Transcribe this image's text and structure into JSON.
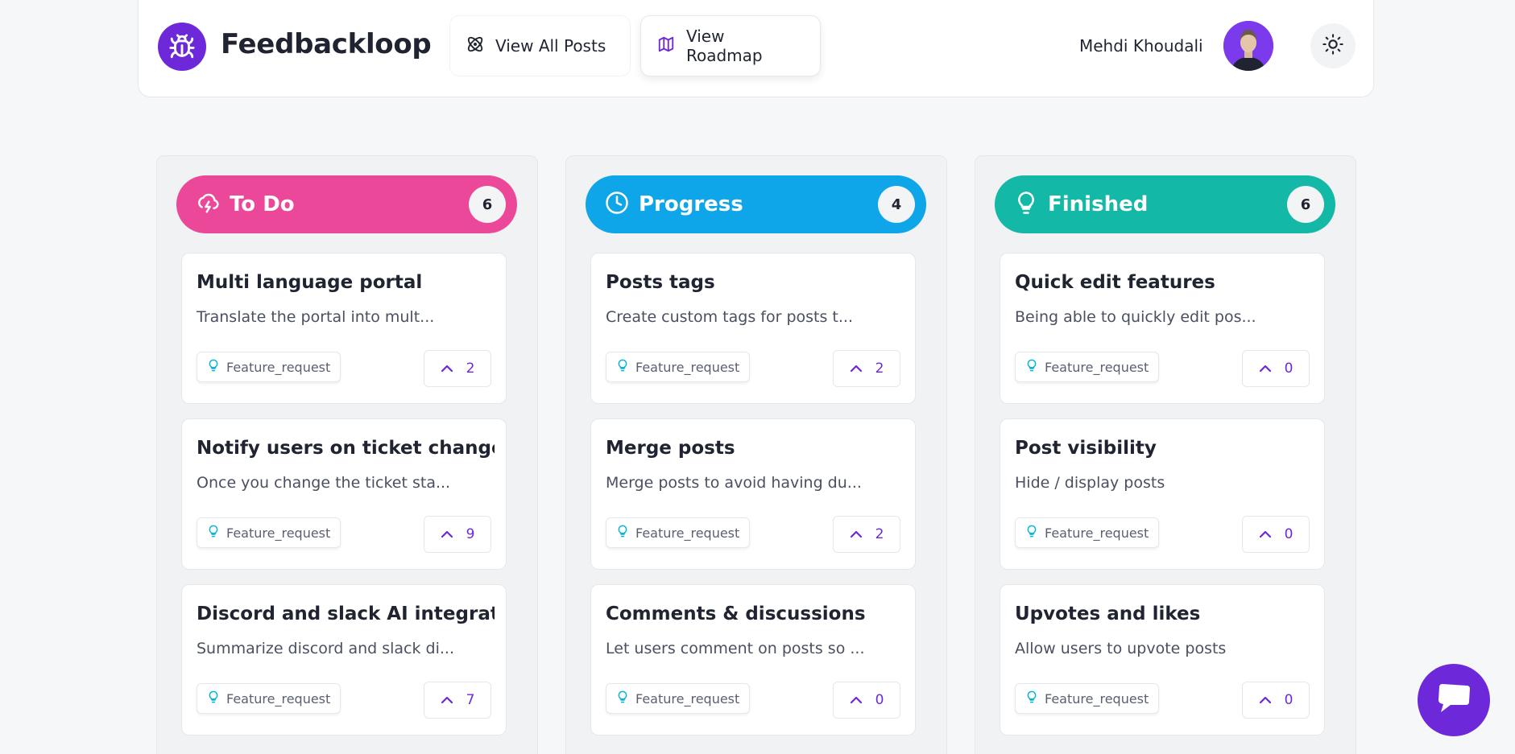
{
  "header": {
    "brand": "Feedbackloop",
    "nav": [
      {
        "label": "View All Posts",
        "icon": "atom-icon"
      },
      {
        "label": "View Roadmap",
        "icon": "map-icon"
      }
    ],
    "user_name": "Mehdi Khoudali"
  },
  "colors": {
    "accent": "#6d28d9",
    "todo": "#ec4899",
    "progress": "#0ea5e9",
    "finished": "#14b8a6",
    "tag_icon": "#06b6d4"
  },
  "columns": [
    {
      "title": "To Do",
      "count": "6",
      "icon": "cloud-lightning-icon",
      "cards": [
        {
          "title": "Multi language portal",
          "desc": "Translate the portal into mult...",
          "tag": "Feature_request",
          "votes": "2"
        },
        {
          "title": "Notify users on ticket change ...",
          "desc": "Once you change the ticket sta...",
          "tag": "Feature_request",
          "votes": "9"
        },
        {
          "title": "Discord and slack AI integrati...",
          "desc": "Summarize discord and slack di...",
          "tag": "Feature_request",
          "votes": "7"
        }
      ]
    },
    {
      "title": "Progress",
      "count": "4",
      "icon": "clock-icon",
      "cards": [
        {
          "title": "Posts tags",
          "desc": "Create custom tags for posts t...",
          "tag": "Feature_request",
          "votes": "2"
        },
        {
          "title": "Merge posts",
          "desc": "Merge posts to avoid having du...",
          "tag": "Feature_request",
          "votes": "2"
        },
        {
          "title": "Comments & discussions",
          "desc": "Let users comment on posts so ...",
          "tag": "Feature_request",
          "votes": "0"
        }
      ]
    },
    {
      "title": "Finished",
      "count": "6",
      "icon": "lightbulb-icon",
      "cards": [
        {
          "title": "Quick edit features",
          "desc": "Being able to quickly edit pos...",
          "tag": "Feature_request",
          "votes": "0"
        },
        {
          "title": "Post visibility",
          "desc": "Hide / display posts",
          "tag": "Feature_request",
          "votes": "0"
        },
        {
          "title": "Upvotes and likes",
          "desc": "Allow users to upvote posts",
          "tag": "Feature_request",
          "votes": "0"
        }
      ]
    }
  ]
}
